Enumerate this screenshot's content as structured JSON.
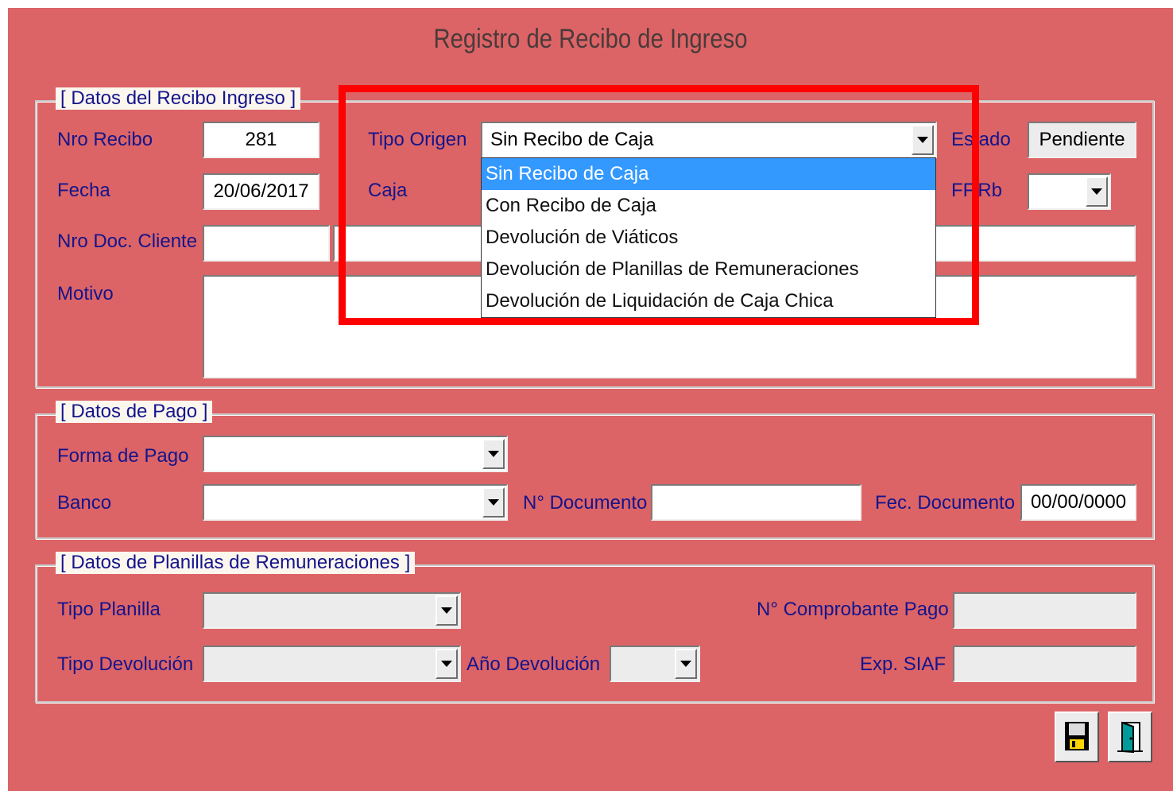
{
  "window": {
    "title": "Registro de Recibo de Ingreso"
  },
  "recibo": {
    "legend": "[ Datos del Recibo Ingreso ]",
    "nro_recibo_label": "Nro Recibo",
    "nro_recibo_value": "281",
    "fecha_label": "Fecha",
    "fecha_value": "20/06/2017",
    "nro_doc_cliente_label": "Nro Doc. Cliente",
    "motivo_label": "Motivo",
    "tipo_origen_label": "Tipo Origen",
    "tipo_origen_value": "Sin Recibo de Caja",
    "tipo_origen_options": [
      "Sin Recibo de Caja",
      "Con Recibo de Caja",
      "Devolución de Viáticos",
      "Devolución de Planillas de Remuneraciones",
      "Devolución de Liquidación de Caja Chica"
    ],
    "caja_label": "Caja",
    "estado_label": "Estado",
    "estado_value": "Pendiente",
    "ff_rb_label": "FF.Rb"
  },
  "pago": {
    "legend": "[ Datos de Pago ]",
    "forma_pago_label": "Forma de Pago",
    "banco_label": "Banco",
    "n_documento_label": "N° Documento",
    "fec_documento_label": "Fec. Documento",
    "fec_documento_value": "00/00/0000"
  },
  "planillas": {
    "legend": "[ Datos de Planillas de Remuneraciones ]",
    "tipo_planilla_label": "Tipo Planilla",
    "tipo_devolucion_label": "Tipo Devolución",
    "anio_devolucion_label": "Año Devolución",
    "n_comprobante_label": "N° Comprobante Pago",
    "exp_siaf_label": "Exp. SIAF"
  },
  "actions": {
    "save_icon": "floppy-disk-icon",
    "exit_icon": "exit-door-icon"
  },
  "colors": {
    "titlebar": "#dc6466",
    "panel": "#fbf6ee",
    "label": "#14148c",
    "selection": "#3399ff",
    "highlight_box": "#ff0000"
  }
}
